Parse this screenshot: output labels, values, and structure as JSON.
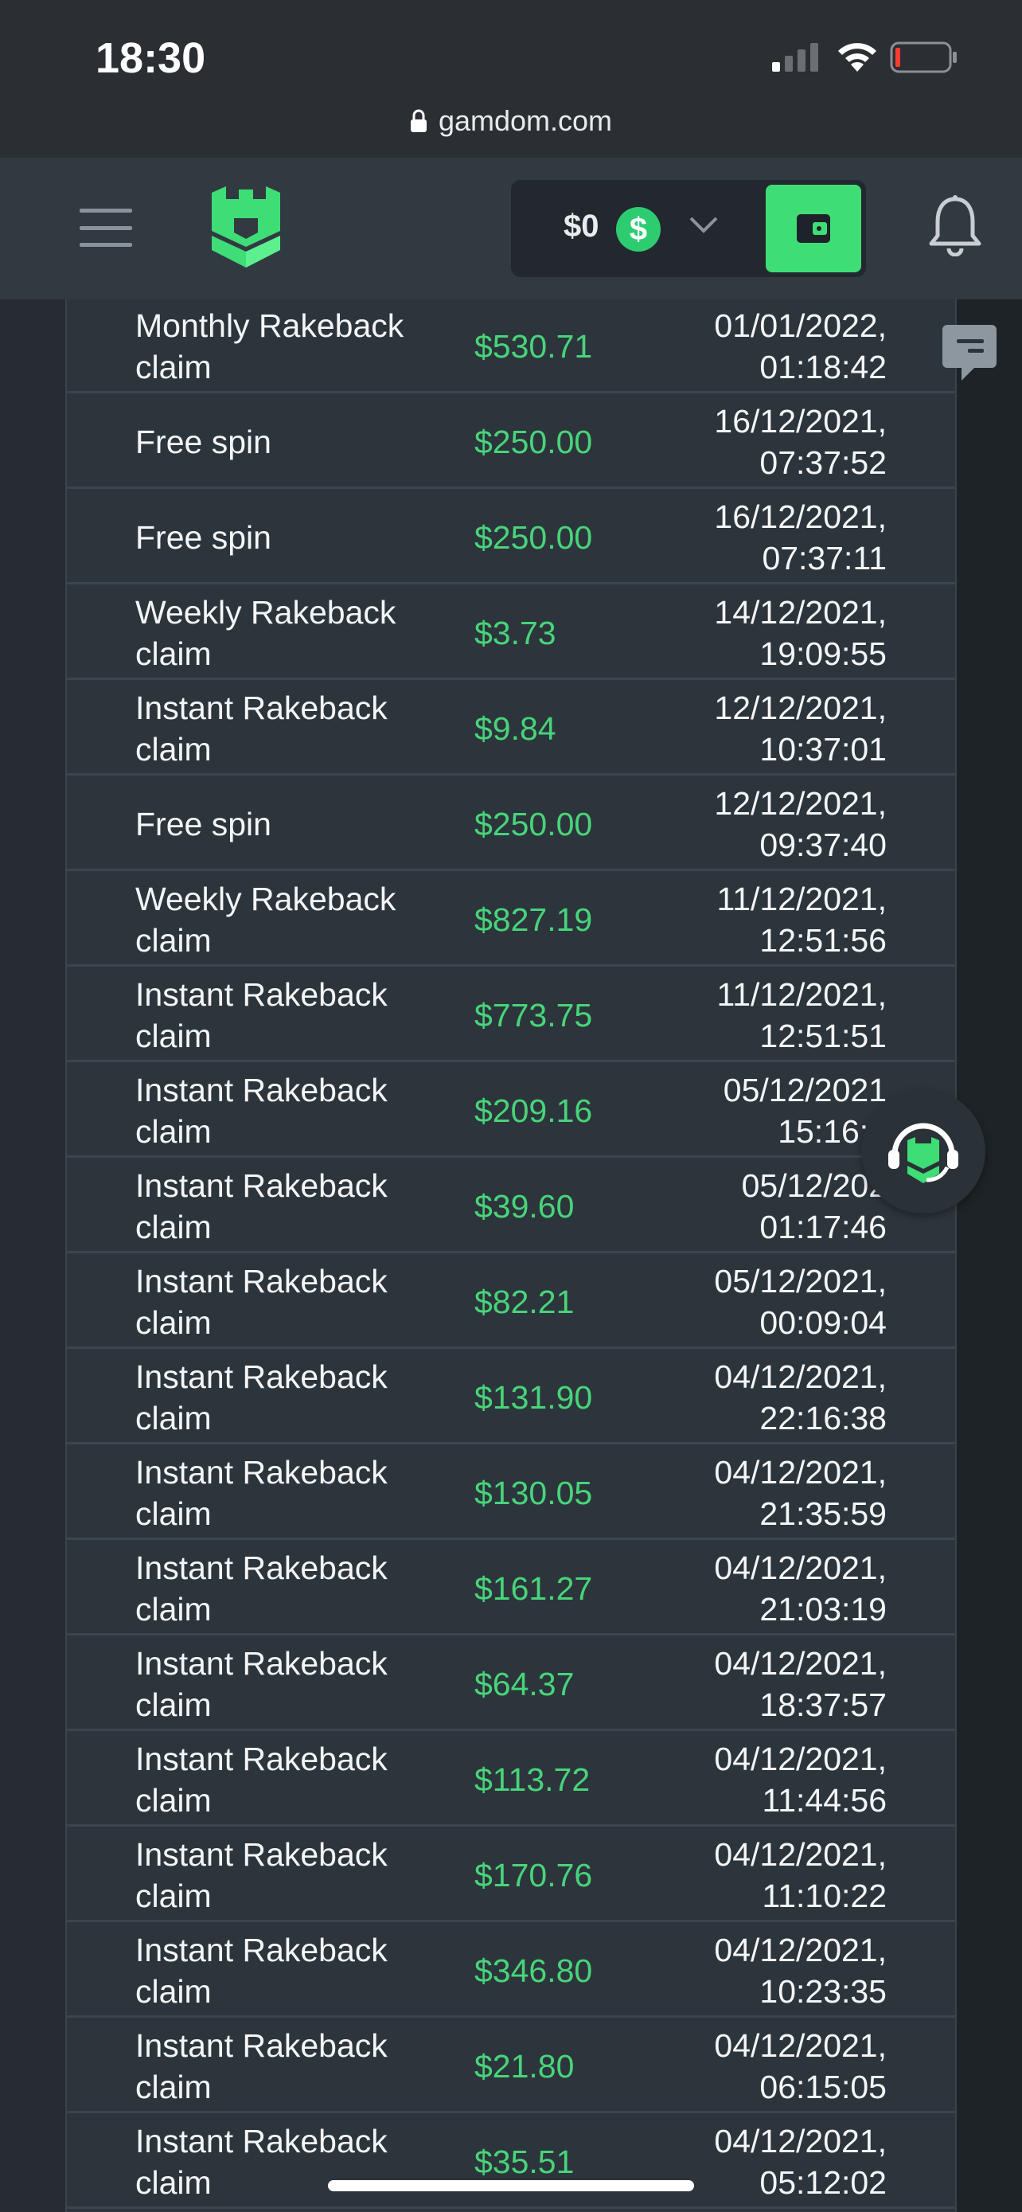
{
  "status_bar": {
    "time": "18:30"
  },
  "browser": {
    "url": "gamdom.com"
  },
  "header": {
    "balance": "$0",
    "currency_symbol": "$"
  },
  "transactions": [
    {
      "type": "Monthly Rakeback claim",
      "amount": "$530.71",
      "date": "01/01/2022,",
      "time": "01:18:42"
    },
    {
      "type": "Free spin",
      "amount": "$250.00",
      "date": "16/12/2021,",
      "time": "07:37:52"
    },
    {
      "type": "Free spin",
      "amount": "$250.00",
      "date": "16/12/2021,",
      "time": "07:37:11"
    },
    {
      "type": "Weekly Rakeback claim",
      "amount": "$3.73",
      "date": "14/12/2021,",
      "time": "19:09:55"
    },
    {
      "type": "Instant Rakeback claim",
      "amount": "$9.84",
      "date": "12/12/2021,",
      "time": "10:37:01"
    },
    {
      "type": "Free spin",
      "amount": "$250.00",
      "date": "12/12/2021,",
      "time": "09:37:40"
    },
    {
      "type": "Weekly Rakeback claim",
      "amount": "$827.19",
      "date": "11/12/2021,",
      "time": "12:51:56"
    },
    {
      "type": "Instant Rakeback claim",
      "amount": "$773.75",
      "date": "11/12/2021,",
      "time": "12:51:51"
    },
    {
      "type": "Instant Rakeback claim",
      "amount": "$209.16",
      "date": "05/12/2021",
      "time": "15:16:3"
    },
    {
      "type": "Instant Rakeback claim",
      "amount": "$39.60",
      "date": "05/12/202",
      "time": "01:17:46"
    },
    {
      "type": "Instant Rakeback claim",
      "amount": "$82.21",
      "date": "05/12/2021,",
      "time": "00:09:04"
    },
    {
      "type": "Instant Rakeback claim",
      "amount": "$131.90",
      "date": "04/12/2021,",
      "time": "22:16:38"
    },
    {
      "type": "Instant Rakeback claim",
      "amount": "$130.05",
      "date": "04/12/2021,",
      "time": "21:35:59"
    },
    {
      "type": "Instant Rakeback claim",
      "amount": "$161.27",
      "date": "04/12/2021,",
      "time": "21:03:19"
    },
    {
      "type": "Instant Rakeback claim",
      "amount": "$64.37",
      "date": "04/12/2021,",
      "time": "18:37:57"
    },
    {
      "type": "Instant Rakeback claim",
      "amount": "$113.72",
      "date": "04/12/2021,",
      "time": "11:44:56"
    },
    {
      "type": "Instant Rakeback claim",
      "amount": "$170.76",
      "date": "04/12/2021,",
      "time": "11:10:22"
    },
    {
      "type": "Instant Rakeback claim",
      "amount": "$346.80",
      "date": "04/12/2021,",
      "time": "10:23:35"
    },
    {
      "type": "Instant Rakeback claim",
      "amount": "$21.80",
      "date": "04/12/2021,",
      "time": "06:15:05"
    },
    {
      "type": "Instant Rakeback claim",
      "amount": "$35.51",
      "date": "04/12/2021,",
      "time": "05:12:02"
    }
  ],
  "colors": {
    "accent_green": "#3fdd76",
    "amount_green": "#48d47a",
    "header_bg": "#323a41",
    "table_bg": "#2d353c"
  },
  "icons": [
    "signal-icon",
    "wifi-icon",
    "battery-icon",
    "lock-icon",
    "menu-icon",
    "logo-icon",
    "dollar-icon",
    "chevron-down-icon",
    "wallet-icon",
    "bell-icon",
    "chat-icon",
    "support-icon"
  ]
}
